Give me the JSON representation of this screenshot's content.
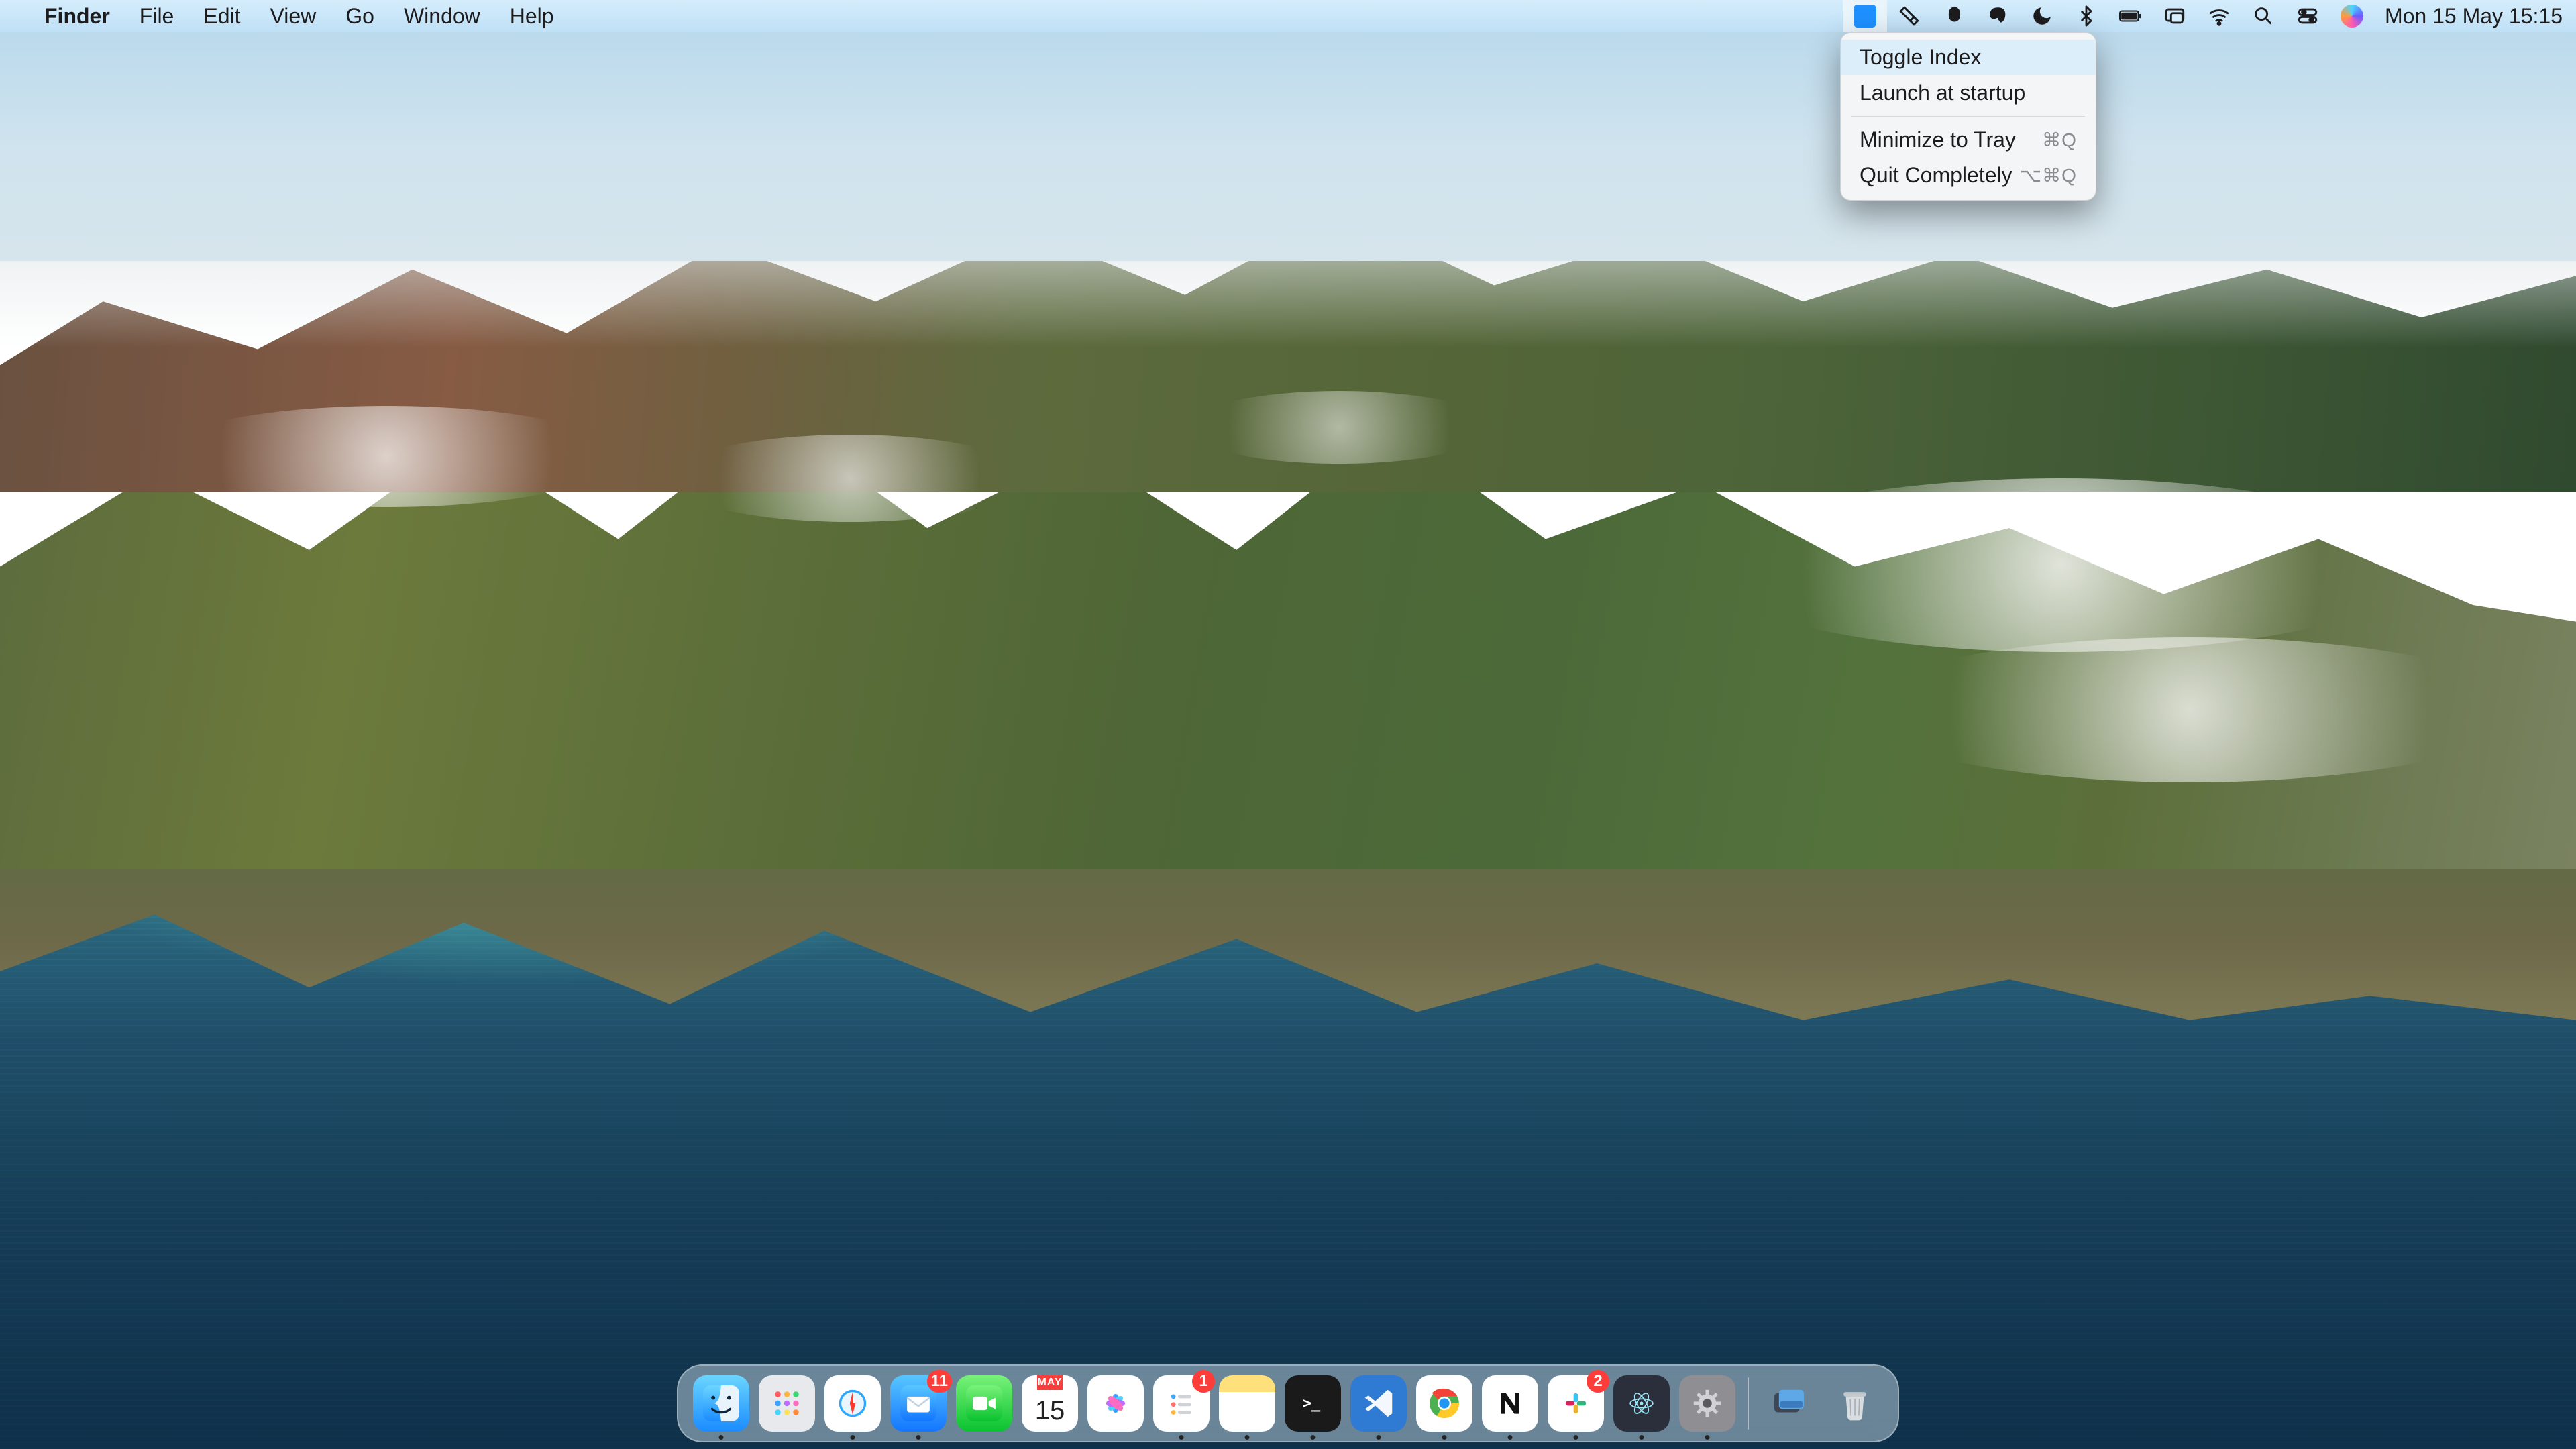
{
  "menubar": {
    "app_name": "Finder",
    "menus": [
      "File",
      "Edit",
      "View",
      "Go",
      "Window",
      "Help"
    ],
    "clock": "Mon 15 May  15:15",
    "status_icons": [
      {
        "name": "app-menu-icon",
        "active": true
      },
      {
        "name": "hammerspoon-icon"
      },
      {
        "name": "bartender-icon"
      },
      {
        "name": "evernote-icon"
      },
      {
        "name": "do-not-disturb-icon"
      },
      {
        "name": "bluetooth-icon"
      },
      {
        "name": "battery-icon"
      },
      {
        "name": "screen-mirroring-icon"
      },
      {
        "name": "wifi-icon"
      },
      {
        "name": "spotlight-icon"
      },
      {
        "name": "control-center-icon"
      },
      {
        "name": "siri-icon"
      }
    ]
  },
  "popup": {
    "items": [
      {
        "label": "Toggle Index",
        "shortcut": "",
        "highlight": true
      },
      {
        "label": "Launch at startup",
        "shortcut": ""
      },
      {
        "sep": true
      },
      {
        "label": "Minimize to Tray",
        "shortcut": "⌘Q"
      },
      {
        "label": "Quit Completely",
        "shortcut": "⌥⌘Q"
      }
    ]
  },
  "dock": {
    "calendar": {
      "month": "MAY",
      "day": "15"
    },
    "apps": [
      {
        "name": "finder",
        "running": true,
        "bg": "linear-gradient(#6bd5ff,#1a8cff)",
        "glyph": "finder"
      },
      {
        "name": "launchpad",
        "running": false,
        "bg": "#e7e9ec",
        "glyph": "grid-color"
      },
      {
        "name": "safari",
        "running": true,
        "bg": "#fff",
        "glyph": "compass"
      },
      {
        "name": "mail",
        "running": true,
        "bg": "linear-gradient(#58c6ff,#1376ff)",
        "glyph": "envelope",
        "badge": "11"
      },
      {
        "name": "facetime",
        "running": false,
        "bg": "linear-gradient(#79f279,#0ac230)",
        "glyph": "video"
      },
      {
        "name": "calendar",
        "running": true,
        "bg": "#fff",
        "glyph": "calendar"
      },
      {
        "name": "photos",
        "running": false,
        "bg": "#fff",
        "glyph": "flower"
      },
      {
        "name": "reminders",
        "running": true,
        "bg": "#fff",
        "glyph": "checklist",
        "badge": "1"
      },
      {
        "name": "notes",
        "running": true,
        "bg": "linear-gradient(#ffe07a 30%,#fff 30%)",
        "glyph": ""
      },
      {
        "name": "terminal",
        "running": true,
        "bg": "#1a1a1a",
        "glyph": "prompt"
      },
      {
        "name": "vscode",
        "running": true,
        "bg": "#2f7bd4",
        "glyph": "vscode"
      },
      {
        "name": "chrome",
        "running": true,
        "bg": "#fff",
        "glyph": "chrome"
      },
      {
        "name": "notion",
        "running": true,
        "bg": "#fff",
        "glyph": "N"
      },
      {
        "name": "slack",
        "running": true,
        "bg": "#fff",
        "glyph": "slack",
        "badge": "2"
      },
      {
        "name": "electron",
        "running": true,
        "bg": "#2b2e3b",
        "glyph": "electron"
      },
      {
        "name": "settings",
        "running": true,
        "bg": "#8e8e93",
        "glyph": "gear"
      }
    ],
    "right": [
      {
        "name": "desktop-stack",
        "glyph": "stack"
      },
      {
        "name": "trash",
        "glyph": "trash"
      }
    ]
  }
}
